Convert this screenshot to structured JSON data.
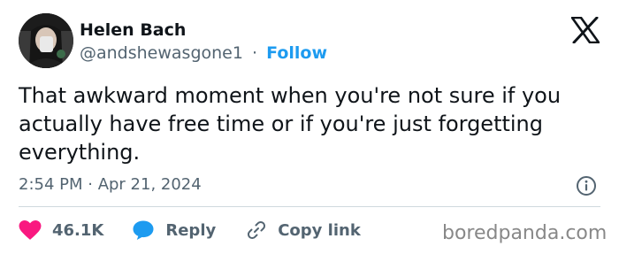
{
  "author": {
    "name": "Helen Bach",
    "handle": "@andshewasgone1",
    "separator": "·",
    "follow_label": "Follow"
  },
  "tweet": {
    "text": "That awkward moment when you're not sure if you actually have free time or if you're just forgetting everything.",
    "timestamp": "2:54 PM · Apr 21, 2024"
  },
  "actions": {
    "likes_count": "46.1K",
    "reply_label": "Reply",
    "copy_link_label": "Copy link"
  },
  "icons": {
    "platform": "x-logo-icon",
    "info": "info-icon",
    "like": "heart-icon",
    "reply": "reply-bubble-icon",
    "copy_link": "link-icon"
  },
  "colors": {
    "follow": "#1d9bf0",
    "heart": "#f91880",
    "reply": "#1d9bf0",
    "muted": "#536471",
    "text": "#0f1419"
  },
  "watermark": "boredpanda.com"
}
